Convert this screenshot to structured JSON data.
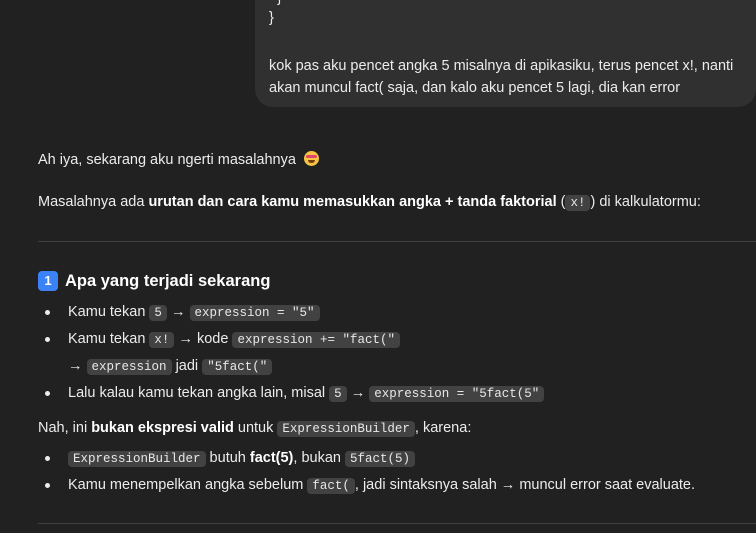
{
  "user_message": {
    "code_tail_top": "}",
    "code_tail": "}",
    "text": "kok pas aku pencet angka 5 misalnya di apikasiku, terus pencet x!, nanti akan muncul fact( saja, dan kalo aku pencet 5 lagi, dia kan error"
  },
  "reply": {
    "intro": "Ah iya, sekarang aku ngerti masalahnya",
    "emoji_icon": "star-struck-face-icon",
    "problem_prefix": "Masalahnya ada ",
    "problem_bold": "urutan dan cara kamu memasukkan angka + tanda faktorial",
    "problem_open": " (",
    "problem_code": "x!",
    "problem_suffix": ") di kalkulatormu:",
    "section1": {
      "badge": "1",
      "title": "Apa yang terjadi sekarang",
      "item1": {
        "prefix": "Kamu tekan ",
        "code1": "5",
        "arrow": " → ",
        "code2": "expression = \"5\""
      },
      "item2": {
        "prefix": "Kamu tekan ",
        "code1": "x!",
        "middle": " → kode ",
        "code2": "expression += \"fact(\"",
        "line2_arrow": "→ ",
        "code3": "expression",
        "jadi": " jadi ",
        "code4": "\"5fact(\""
      },
      "item3": {
        "prefix": "Lalu kalau kamu tekan angka lain, misal ",
        "code1": "5",
        "arrow": " → ",
        "code2": "expression = \"5fact(5\""
      }
    },
    "invalid": {
      "prefix": "Nah, ini ",
      "bold": "bukan ekspresi valid",
      "middle": " untuk ",
      "code": "ExpressionBuilder",
      "suffix": ", karena:"
    },
    "reasons": {
      "item1": {
        "code1": "ExpressionBuilder",
        "middle": " butuh ",
        "bold": "fact(5)",
        "middle2": ", bukan ",
        "code2": "5fact(5)"
      },
      "item2": {
        "prefix": "Kamu menempelkan angka sebelum ",
        "code": "fact(",
        "suffix": ", jadi sintaksnya salah → muncul error saat evaluate."
      }
    }
  }
}
